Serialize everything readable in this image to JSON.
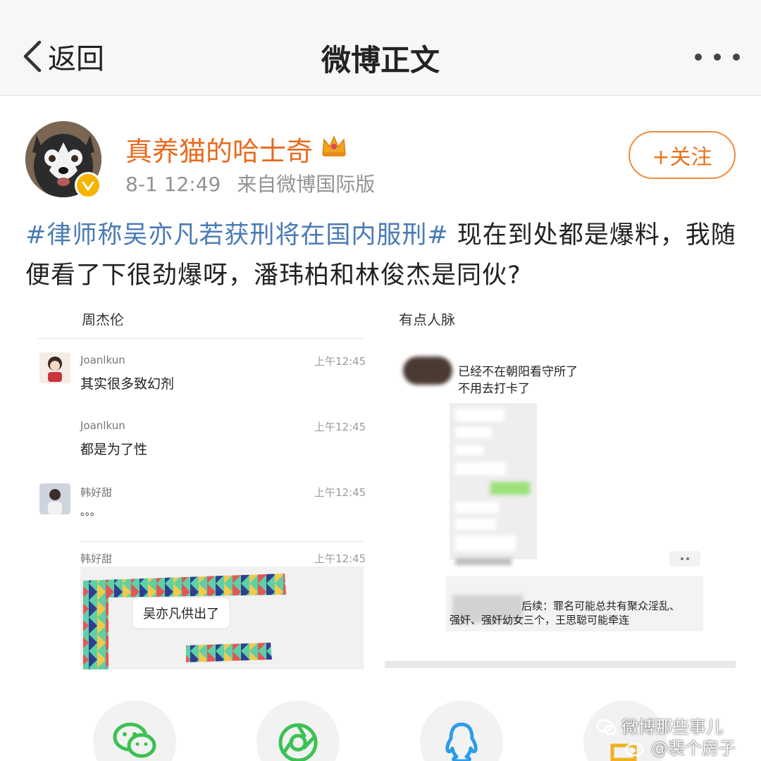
{
  "header": {
    "back_label": "返回",
    "title": "微博正文"
  },
  "post": {
    "author": "真养猫的哈士奇",
    "time": "8-1 12:49",
    "source": "来自微博国际版",
    "follow_label": "+关注",
    "hashtag": "#律师称吴亦凡若获刑将在国内服刑#",
    "body": " 现在到处都是爆料，我随便看了下很劲爆呀，潘玮柏和林俊杰是同伙?"
  },
  "left_image": {
    "cut_header": "周杰伦",
    "messages": [
      {
        "name": "Joanlkun",
        "time": "上午12:45",
        "text": "其实很多致幻剂"
      },
      {
        "name": "Joanlkun",
        "time": "上午12:45",
        "text": "都是为了性"
      },
      {
        "name": "韩好甜",
        "time": "上午12:45",
        "text": "。。。"
      },
      {
        "name": "韩好甜",
        "time": "上午12:45",
        "text": ""
      }
    ],
    "sticker_text": "吴亦凡供出了"
  },
  "right_image": {
    "cut_header": "有点人脉",
    "line1": "已经不在朝阳看守所了",
    "line2": "不用去打卡了",
    "footer1": "后续：罪名可能总共有聚众淫乱、",
    "footer2": "强奸、强奸幼女三个，王思聪可能牵连"
  },
  "share_targets": [
    "wechat-icon",
    "moments-icon",
    "qq-icon",
    "qzone-icon"
  ],
  "watermarks": {
    "line1": "微博那些事儿",
    "line2": "@裴个房子"
  },
  "colors": {
    "username": "#e86b1e",
    "hashtag": "#4a7bb5",
    "follow": "#e8731f",
    "verified": "#f5b400",
    "wechat": "#3cc153",
    "qq": "#2c9ce9"
  }
}
